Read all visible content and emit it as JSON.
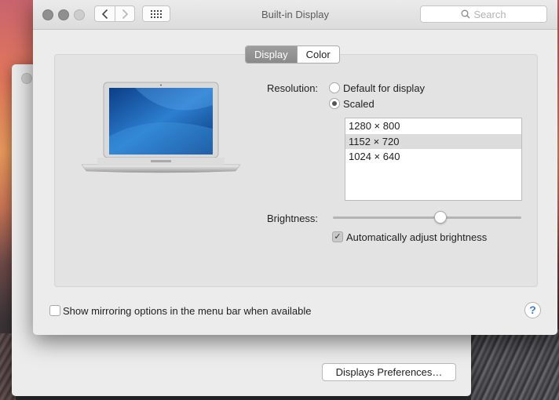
{
  "window": {
    "title": "Built-in Display"
  },
  "toolbar": {
    "search_placeholder": "Search"
  },
  "tabs": [
    {
      "label": "Display",
      "active": true
    },
    {
      "label": "Color",
      "active": false
    }
  ],
  "resolution": {
    "label": "Resolution:",
    "options": [
      {
        "label": "Default for display",
        "selected": false
      },
      {
        "label": "Scaled",
        "selected": true
      }
    ],
    "list": [
      {
        "value": "1280 × 800",
        "selected": false
      },
      {
        "value": "1152 × 720",
        "selected": true
      },
      {
        "value": "1024 × 640",
        "selected": false
      }
    ]
  },
  "brightness": {
    "label": "Brightness:",
    "level": 0.57,
    "auto_label": "Automatically adjust brightness",
    "auto_checked": true
  },
  "mirroring": {
    "label": "Show mirroring options in the menu bar when available",
    "checked": false
  },
  "help": {
    "label": "?"
  },
  "background_window": {
    "button_label": "Displays Preferences…"
  }
}
